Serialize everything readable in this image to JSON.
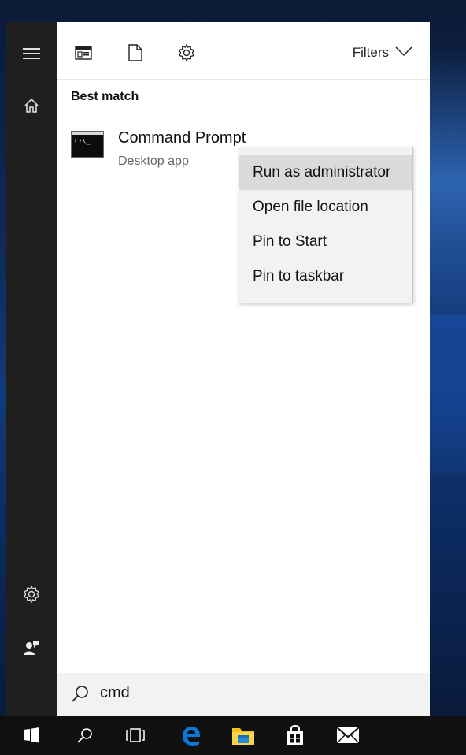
{
  "panel": {
    "filters_label": "Filters",
    "best_match_heading": "Best match"
  },
  "result": {
    "title": "Command Prompt",
    "subtitle": "Desktop app",
    "icon_text": "C:\\_"
  },
  "context_menu": {
    "items": [
      {
        "label": "Run as administrator",
        "highlighted": true
      },
      {
        "label": "Open file location",
        "highlighted": false
      },
      {
        "label": "Pin to Start",
        "highlighted": false
      },
      {
        "label": "Pin to taskbar",
        "highlighted": false
      }
    ]
  },
  "search": {
    "value": "cmd"
  },
  "icons": {
    "rail": [
      "hamburger-icon",
      "home-icon",
      "settings-icon",
      "feedback-icon"
    ],
    "header": [
      "apps-filter-icon",
      "documents-filter-icon",
      "settings-filter-icon",
      "chevron-down-icon"
    ],
    "taskbar": [
      "windows-start-icon",
      "search-icon",
      "task-view-icon",
      "edge-icon",
      "file-explorer-icon",
      "store-icon",
      "mail-icon"
    ]
  },
  "colors": {
    "rail_bg": "#1f1f1f",
    "taskbar_bg": "#101010",
    "menu_bg": "#f2f2f2",
    "menu_highlight": "#dadada",
    "edge_blue": "#0a78d7",
    "explorer_yellow": "#f3c218"
  }
}
